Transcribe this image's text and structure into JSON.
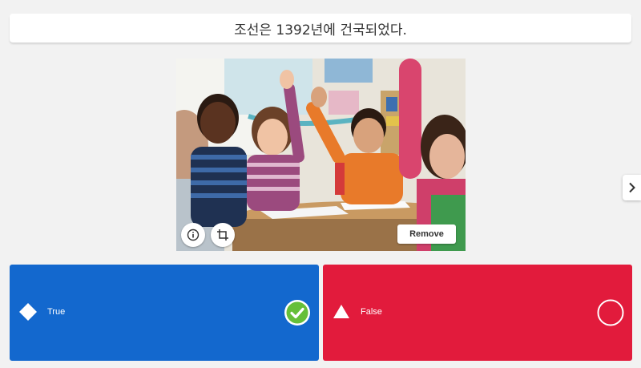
{
  "question": {
    "text": "조선은 1392년에 건국되었다."
  },
  "media": {
    "description_icon": "classroom-photo",
    "info_icon": "info-icon",
    "crop_icon": "crop-icon",
    "remove_label": "Remove"
  },
  "navigation": {
    "next_icon": "chevron-right-icon"
  },
  "answers": [
    {
      "label": "True",
      "shape": "diamond",
      "color": "#1368ce",
      "correct": true
    },
    {
      "label": "False",
      "shape": "triangle",
      "color": "#e21b3c",
      "correct": false
    }
  ],
  "colors": {
    "correct_green": "#66bf39"
  }
}
